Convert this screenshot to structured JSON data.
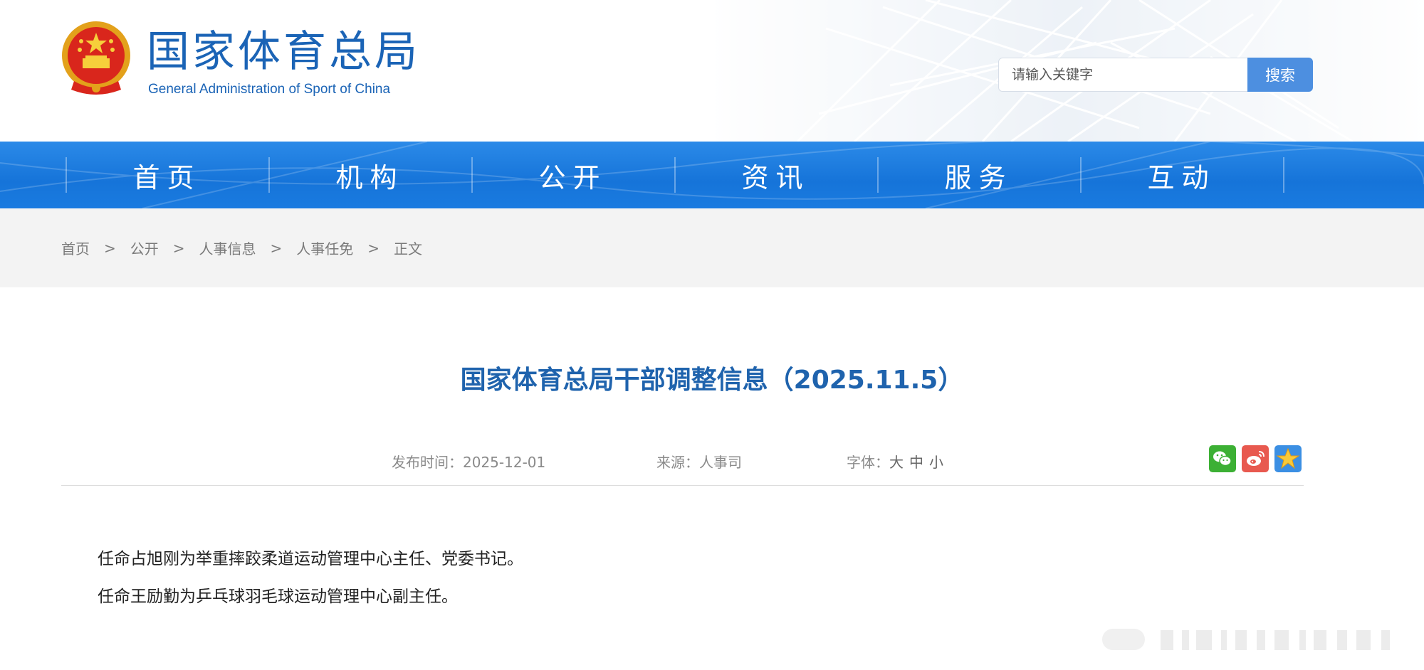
{
  "header": {
    "title_cn": "国家体育总局",
    "title_en": "General Administration of Sport of China",
    "search": {
      "placeholder": "请输入关键字",
      "button_label": "搜索"
    }
  },
  "nav": {
    "items": [
      {
        "label": "首页"
      },
      {
        "label": "机构"
      },
      {
        "label": "公开"
      },
      {
        "label": "资讯"
      },
      {
        "label": "服务"
      },
      {
        "label": "互动"
      }
    ]
  },
  "breadcrumb": {
    "items": [
      "首页",
      "公开",
      "人事信息",
      "人事任免",
      "正文"
    ],
    "separator": ">"
  },
  "article": {
    "title": "国家体育总局干部调整信息（2025.11.5）",
    "meta": {
      "publish_label": "发布时间：",
      "publish_date": "2025-12-01",
      "source_label": "来源：",
      "source": "人事司",
      "font_label": "字体：",
      "font_large": "大",
      "font_medium": "中",
      "font_small": "小"
    },
    "paragraphs": [
      "任命占旭刚为举重摔跤柔道运动管理中心主任、党委书记。",
      "任命王励勤为乒乓球羽毛球运动管理中心副主任。"
    ],
    "share_icons": [
      "wechat-icon",
      "weibo-icon",
      "favorite-star-icon"
    ]
  },
  "colors": {
    "brand_blue": "#1b64b6",
    "nav_blue": "#1674d9",
    "search_button": "#4d8fe0",
    "title_blue": "#1f63ad"
  }
}
